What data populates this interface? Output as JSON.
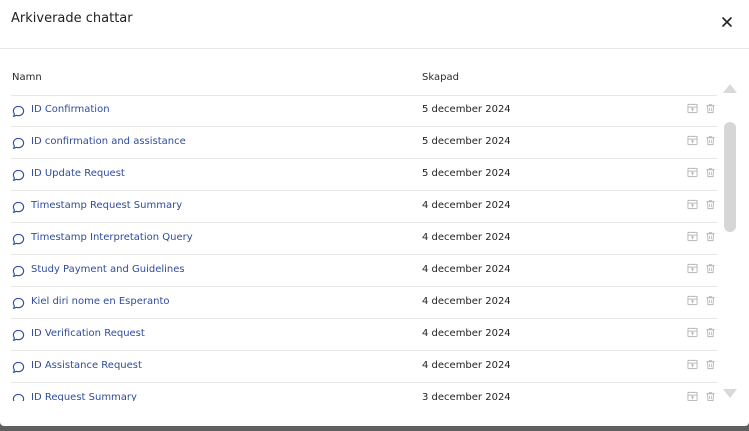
{
  "dialog": {
    "title": "Arkiverade chattar",
    "close_icon": "close-icon"
  },
  "table": {
    "columns": [
      "Namn",
      "Skapad"
    ],
    "rows": [
      {
        "name": "ID Confirmation",
        "created": "5 december 2024"
      },
      {
        "name": "ID confirmation and assistance",
        "created": "5 december 2024"
      },
      {
        "name": "ID Update Request",
        "created": "5 december 2024"
      },
      {
        "name": "Timestamp Request Summary",
        "created": "4 december 2024"
      },
      {
        "name": "Timestamp Interpretation Query",
        "created": "4 december 2024"
      },
      {
        "name": "Study Payment and Guidelines",
        "created": "4 december 2024"
      },
      {
        "name": "Kiel diri nome en Esperanto",
        "created": "4 december 2024"
      },
      {
        "name": "ID Verification Request",
        "created": "4 december 2024"
      },
      {
        "name": "ID Assistance Request",
        "created": "4 december 2024"
      },
      {
        "name": "ID Request Summary",
        "created": "3 december 2024"
      }
    ],
    "row_icons": [
      "chat-bubble-icon",
      "unarchive-icon",
      "trash-icon"
    ]
  },
  "colors": {
    "link": "#2f4c9c",
    "icon_muted": "#b5b5b5",
    "divider": "#e6e6e6",
    "overlay": "#5f5f5f"
  }
}
